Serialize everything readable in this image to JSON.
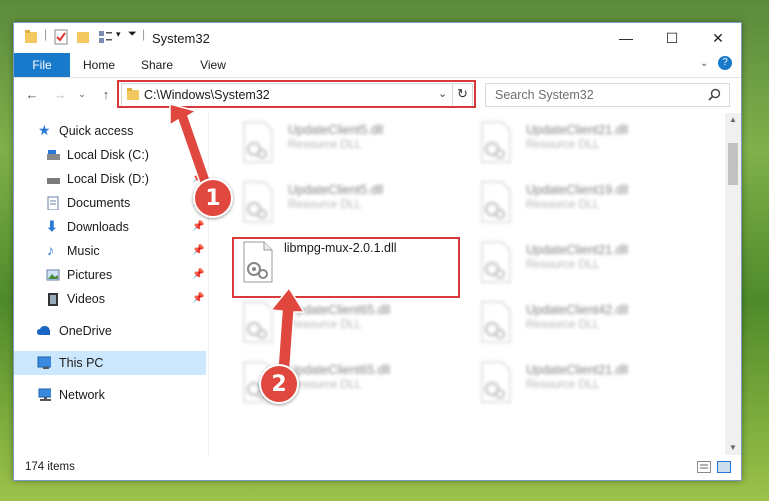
{
  "window": {
    "title": "System32",
    "controls": {
      "minimize": "—",
      "maximize": "☐",
      "close": "✕"
    }
  },
  "ribbon": {
    "tabs": [
      {
        "label": "File",
        "active": true
      },
      {
        "label": "Home"
      },
      {
        "label": "Share"
      },
      {
        "label": "View"
      }
    ]
  },
  "address": {
    "path": "C:\\Windows\\System32"
  },
  "search": {
    "placeholder": "Search System32"
  },
  "sidebar": {
    "items": [
      {
        "label": "Quick access",
        "icon": "star-icon"
      },
      {
        "label": "Local Disk (C:)",
        "icon": "drive-icon",
        "pinned": true
      },
      {
        "label": "Local Disk (D:)",
        "icon": "drive-icon",
        "pinned": true
      },
      {
        "label": "Documents",
        "icon": "documents-icon",
        "pinned": true
      },
      {
        "label": "Downloads",
        "icon": "download-icon",
        "pinned": true
      },
      {
        "label": "Music",
        "icon": "music-icon",
        "pinned": true
      },
      {
        "label": "Pictures",
        "icon": "pictures-icon",
        "pinned": true
      },
      {
        "label": "Videos",
        "icon": "videos-icon",
        "pinned": true
      },
      {
        "label": "OneDrive",
        "icon": "cloud-icon"
      },
      {
        "label": "This PC",
        "icon": "computer-icon",
        "selected": true
      },
      {
        "label": "Network",
        "icon": "network-icon"
      }
    ]
  },
  "files": [
    {
      "name": "UpdateClient5.dll",
      "type": "Resource DLL"
    },
    {
      "name": "UpdateClient21.dll",
      "type": "Resource DLL"
    },
    {
      "name": "UpdateClient5.dll",
      "type": "Resource DLL"
    },
    {
      "name": "UpdateClient19.dll",
      "type": "Resource DLL"
    },
    {
      "name": "libmpg-mux-2.0.1.dll",
      "type": ""
    },
    {
      "name": "UpdateClient21.dll",
      "type": "Resource DLL"
    },
    {
      "name": "UpdateClient65.dll",
      "type": "Resource DLL"
    },
    {
      "name": "UpdateClient42.dll",
      "type": "Resource DLL"
    },
    {
      "name": "UpdateClient65.dll",
      "type": "Resource DLL"
    },
    {
      "name": "UpdateClient21.dll",
      "type": "Resource DLL"
    }
  ],
  "status": {
    "item_count": "174 items"
  },
  "annotations": {
    "step1": "1",
    "step2": "2",
    "accent": "#d63a3a"
  }
}
